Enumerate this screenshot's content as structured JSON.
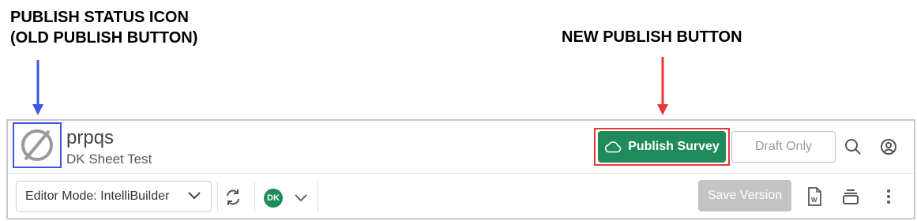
{
  "annotations": {
    "left_label_line1": "PUBLISH STATUS ICON",
    "left_label_line2": "(OLD PUBLISH BUTTON)",
    "right_label": "NEW PUBLISH BUTTON",
    "left_arrow_color": "#3d55e8",
    "right_arrow_color": "#e53935"
  },
  "header": {
    "status_icon": "prohibited-circle-icon",
    "survey_name": "prpqs",
    "survey_subtitle": "DK Sheet Test",
    "publish_label": "Publish Survey",
    "publish_icon": "cloud-icon",
    "draft_label": "Draft Only",
    "search_icon": "search-icon",
    "account_icon": "user-circle-icon"
  },
  "toolbar": {
    "editor_mode_label": "Editor Mode: IntelliBuilder",
    "refresh_icon": "refresh-icon",
    "avatar_initials": "DK",
    "save_label": "Save Version",
    "word_icon": "word-document-icon",
    "layers_icon": "layers-icon",
    "more_icon": "more-vertical-icon"
  },
  "colors": {
    "publish_green": "#1f8a5b",
    "save_disabled_gray": "#c4c4c4",
    "draft_border": "#b7bde3"
  }
}
